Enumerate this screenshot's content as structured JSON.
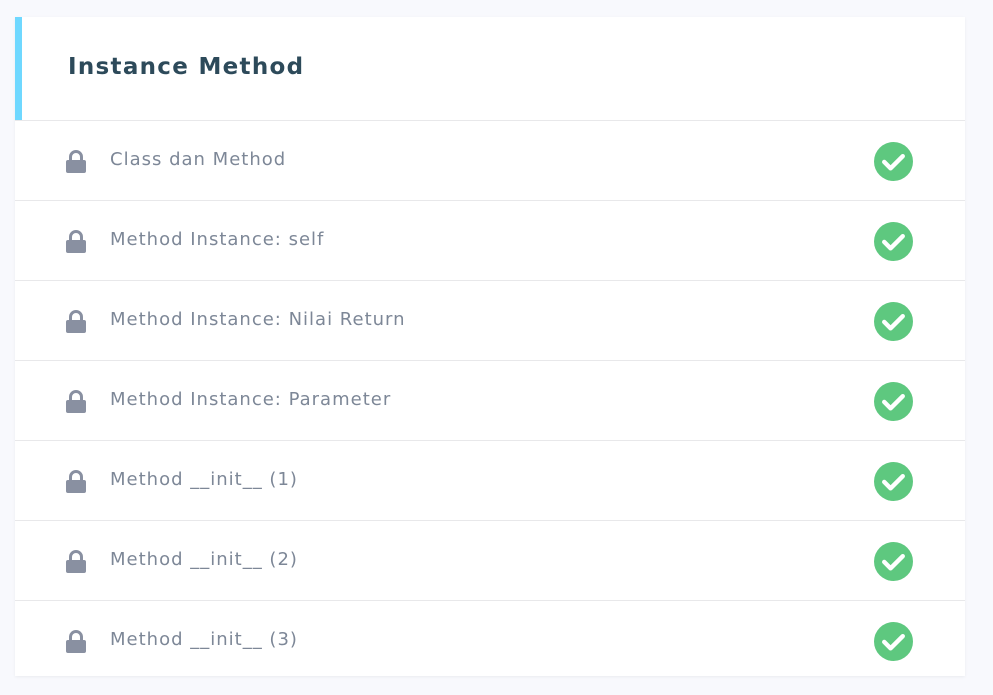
{
  "section": {
    "title": "Instance Method",
    "accent_color": "#6fd8ff"
  },
  "lessons": [
    {
      "title": "Class dan Method",
      "locked_icon": "lock-icon",
      "status_icon": "check-circle-icon",
      "completed": true
    },
    {
      "title": "Method Instance: self",
      "locked_icon": "lock-icon",
      "status_icon": "check-circle-icon",
      "completed": true
    },
    {
      "title": "Method Instance: Nilai Return",
      "locked_icon": "lock-icon",
      "status_icon": "check-circle-icon",
      "completed": true
    },
    {
      "title": "Method Instance: Parameter",
      "locked_icon": "lock-icon",
      "status_icon": "check-circle-icon",
      "completed": true
    },
    {
      "title": "Method __init__ (1)",
      "locked_icon": "lock-icon",
      "status_icon": "check-circle-icon",
      "completed": true
    },
    {
      "title": "Method __init__ (2)",
      "locked_icon": "lock-icon",
      "status_icon": "check-circle-icon",
      "completed": true
    },
    {
      "title": "Method __init__ (3)",
      "locked_icon": "lock-icon",
      "status_icon": "check-circle-icon",
      "completed": true
    }
  ],
  "colors": {
    "check": "#5ec87f",
    "lock": "#8990a1",
    "text": "#7d8797",
    "title": "#2d4a5a"
  }
}
